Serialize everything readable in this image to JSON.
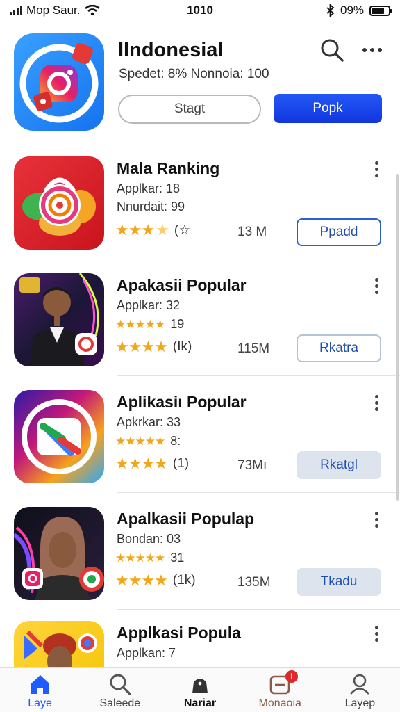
{
  "status_bar": {
    "carrier": "Mop Saur.",
    "time": "1010",
    "battery": "09%"
  },
  "header": {
    "title": "IIndonesial",
    "subtitle": "Spedet: 8% Nonnoia: 100",
    "start_label": "Stagt",
    "primary_label": "Popk",
    "icon": "instagram-like-app-icon"
  },
  "apps": [
    {
      "title": "Mala Ranking",
      "line1": "Applkar: 18",
      "line2": "Nnurdait: 99",
      "rating": "(☆",
      "size": "13 M",
      "action": "Ppadd",
      "icon": "colorful-lock-app-icon"
    },
    {
      "title": "Apakasii Popular",
      "line1": "Applkar: 32",
      "line2": "19",
      "rating": "(Ik)",
      "size": "115M",
      "action": "Rkatra",
      "icon": "man-portrait-app-icon"
    },
    {
      "title": "Aplikasiı Popular",
      "line1": "Apkrkar: 33",
      "line2": "8:",
      "rating": "(1)",
      "size": "73Mı",
      "action": "Rkatgl",
      "icon": "rainbow-app-icon"
    },
    {
      "title": "Apalkasii Populap",
      "line1": "Bondan: 03",
      "line2": "31",
      "rating": "(1k)",
      "size": "135M",
      "action": "Tkadu",
      "icon": "woman-portrait-app-icon"
    },
    {
      "title": "Applkasi Popula",
      "line1": "Applkan: 7",
      "icon": "yellow-portrait-app-icon"
    }
  ],
  "tabs": [
    {
      "label": "Laye",
      "icon": "home-icon"
    },
    {
      "label": "Saleede",
      "icon": "search-icon"
    },
    {
      "label": "Nariar",
      "icon": "bag-icon"
    },
    {
      "label": "Monaoia",
      "icon": "updates-icon",
      "badge": "1"
    },
    {
      "label": "Layep",
      "icon": "profile-icon"
    }
  ],
  "colors": {
    "accent": "#1f5cff",
    "star": "#f4a619",
    "badge": "#e0282a"
  }
}
